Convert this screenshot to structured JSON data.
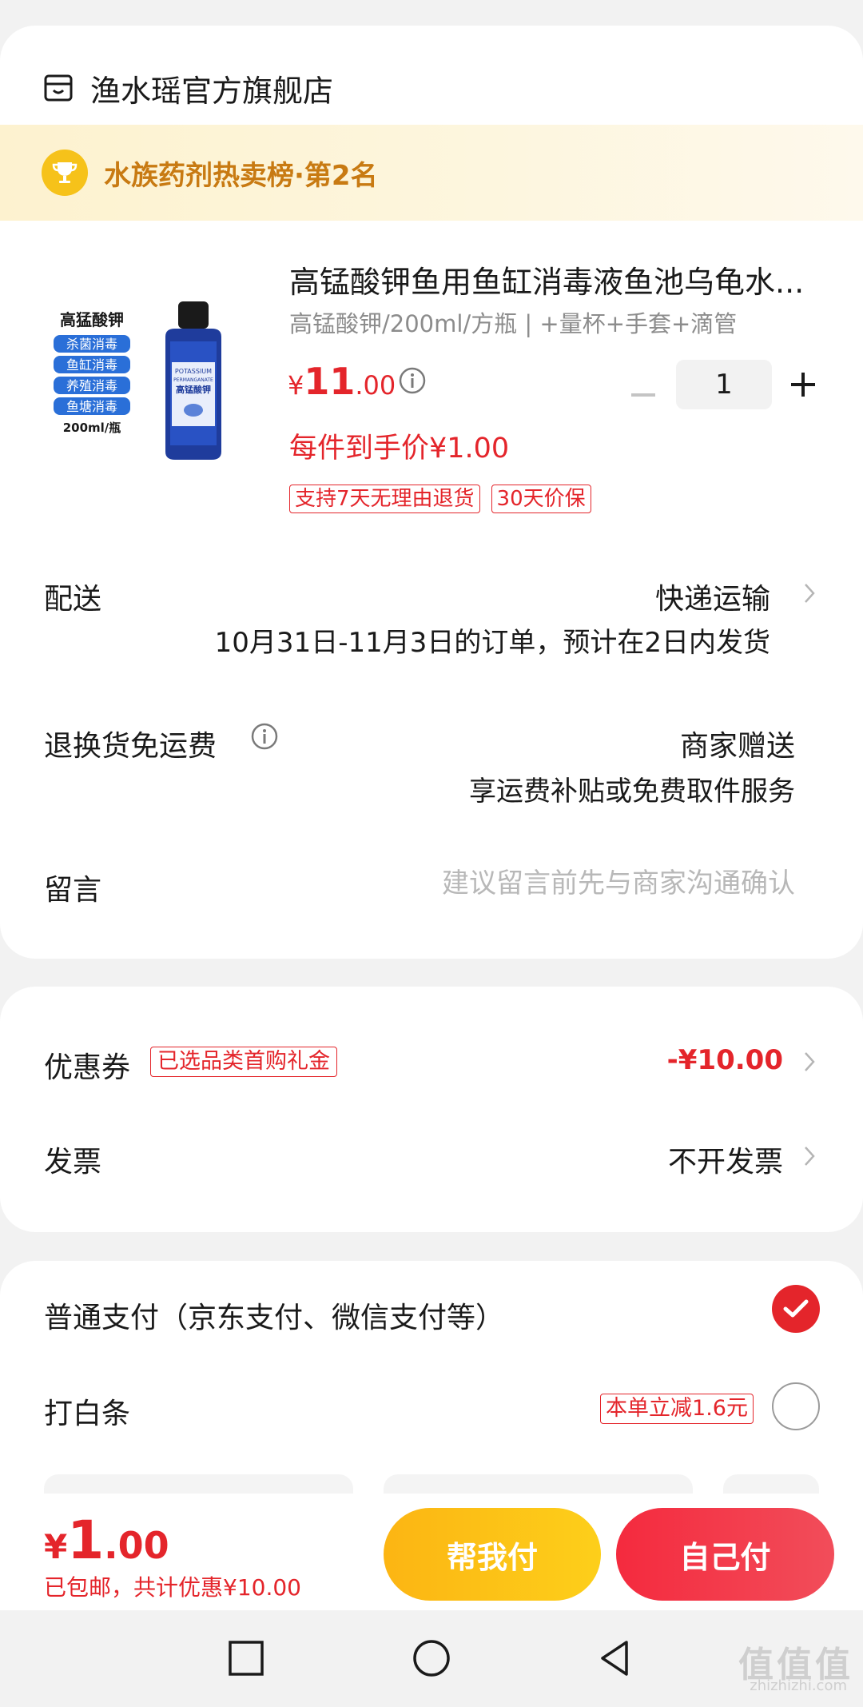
{
  "store": {
    "name": "渔水瑶官方旗舰店"
  },
  "rank": {
    "text": "水族药剂热卖榜·第2名"
  },
  "product": {
    "title": "高锰酸钾鱼用鱼缸消毒液鱼池乌龟水...",
    "spec": "高锰酸钾/200ml/方瓶 | +量杯+手套+滴管",
    "price_symbol": "¥",
    "price_int": "11",
    "price_dec": ".00",
    "quantity": "1",
    "each_price": "每件到手价¥1.00",
    "tags": [
      "支持7天无理由退货",
      "30天价保"
    ],
    "image": {
      "name": "高猛酸钾",
      "badges": [
        "杀菌消毒",
        "鱼缸消毒",
        "养殖消毒",
        "鱼塘消毒"
      ],
      "volume": "200ml/瓶",
      "bottle_text": [
        "POTASSIUM",
        "PERMANGANATE",
        "高锰酸钾"
      ]
    }
  },
  "shipping": {
    "label": "配送",
    "method": "快递运输",
    "note": "10月31日-11月3日的订单，预计在2日内发货"
  },
  "returns": {
    "label": "退换货免运费",
    "value": "商家赠送",
    "note": "享运费补贴或免费取件服务"
  },
  "message": {
    "label": "留言",
    "placeholder": "建议留言前先与商家沟通确认"
  },
  "coupon": {
    "label": "优惠券",
    "tag": "已选品类首购礼金",
    "value": "-¥10.00"
  },
  "invoice": {
    "label": "发票",
    "value": "不开发票"
  },
  "payment": {
    "normal_label": "普通支付（京东支付、微信支付等）",
    "baitiao_label": "打白条",
    "baitiao_tag": "本单立减1.6元"
  },
  "total": {
    "symbol": "¥",
    "int": "1",
    "dec": ".00",
    "note_shipping": "已包邮，",
    "note_discount": "共计优惠¥10.00"
  },
  "buttons": {
    "help_pay": "帮我付",
    "self_pay": "自己付"
  },
  "watermark": {
    "text": "值值值",
    "sub": "zhizhizhi.com"
  },
  "colors": {
    "accent": "#e4252b",
    "help_pay": "#fcb513",
    "rank_text": "#c87a12"
  }
}
